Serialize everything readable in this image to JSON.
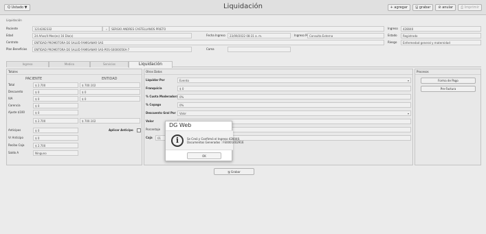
{
  "topbar": {
    "menu_label": "Q Ustado ▼",
    "title": "Liquidación",
    "actions": [
      "+ agregar",
      "🖫 grabar",
      "⊘ anular",
      "⎙ Imprimir"
    ]
  },
  "section_label": "Liquidación",
  "info": {
    "paciente_label": "Paciente",
    "paciente_id": "1214282332",
    "paciente_name": "SERGIO ANDRES CASTELLANOS PRIETO",
    "ingreso_label": "Ingreso",
    "ingreso_value": "428040",
    "edad_label": "Edad",
    "edad_value": "24 Años/4 Mes(es) 16 Día(s)",
    "fecha_label": "Fecha Ingreso",
    "fecha_value": "23/09/2022 08:31 a. m.",
    "ingreso_por_label": "Ingreso Por",
    "ingreso_por_value": "Consulta Externa",
    "estado_label": "Estado",
    "estado_value": "Registrado",
    "contrato_label": "Contrato",
    "contrato_value": "ENTIDAD PROMOTORA DE SALUD FAMISANAR SAS",
    "riesgo_label": "Riesgo",
    "riesgo_value": "Enfermedad general y maternidad",
    "plan_label": "Plan Beneficios",
    "plan_value": "ENTIDAD PROMOTORA DE SALUD FAMISANAR SAS-POS-S0000056A-7",
    "cama_label": "Cama",
    "cama_value": ""
  },
  "tabs": [
    "Ingreso",
    "Medico",
    "Servicios",
    "Liquidación"
  ],
  "totales": {
    "header": "Totales",
    "col_paciente": "PACIENTE",
    "col_entidad": "ENTIDAD",
    "rows": [
      {
        "label": "Total",
        "paciente": "$ 2.700",
        "entidad": "$ 700.102"
      },
      {
        "label": "Descuento",
        "paciente": "$ 0",
        "entidad": "$ 0"
      },
      {
        "label": "IVA",
        "paciente": "$ 0",
        "entidad": "$ 0"
      },
      {
        "label": "Carencia",
        "paciente": "$ 0",
        "entidad": ""
      },
      {
        "label": "Ajuste $100",
        "paciente": "$ 0",
        "entidad": ""
      },
      {
        "label": "",
        "paciente": "$ 2.700",
        "entidad": "$ 700.102"
      }
    ],
    "anticipos_label": "Anticipos",
    "anticipos_value": "$ 0",
    "aplicar_label": "Aplicar Anticipo",
    "vr_anticipo_label": "Vr Anticipo",
    "vr_anticipo_value": "$ 0",
    "recibo_label": "Recibo Caja",
    "recibo_value": "$ 2.700",
    "saldo_label": "Saldo A",
    "saldo_value": "Ninguno"
  },
  "otros": {
    "header": "Otros Datos",
    "rows": [
      {
        "label": "Liquidar Por",
        "value": "Evento",
        "select": true
      },
      {
        "label": "Franquicia",
        "value": "$ 0",
        "select": false
      },
      {
        "label": "% Cuota Moderadora",
        "value": "0%",
        "select": false
      },
      {
        "label": "% Copago",
        "value": "0%",
        "select": false
      },
      {
        "label": "Descuento Gral Por",
        "value": "Valor",
        "select": true
      },
      {
        "label": "Valor",
        "value": "",
        "select": false
      },
      {
        "label": "Porcentaje",
        "value": "",
        "select": false
      },
      {
        "label": "Caja",
        "value": "01",
        "select": false
      }
    ]
  },
  "procesos": {
    "header": "Procesos",
    "buttons": [
      "Forma de Pago",
      "Pre-Factura"
    ]
  },
  "grabar_label": "🖫 Grabar",
  "dialog": {
    "title": "DG Web",
    "message_line1": "Se Creó y Confirmó el Ingreso 428040.",
    "message_line2": "Documentos Generados : FE0001402916",
    "ok_label": "OK"
  }
}
